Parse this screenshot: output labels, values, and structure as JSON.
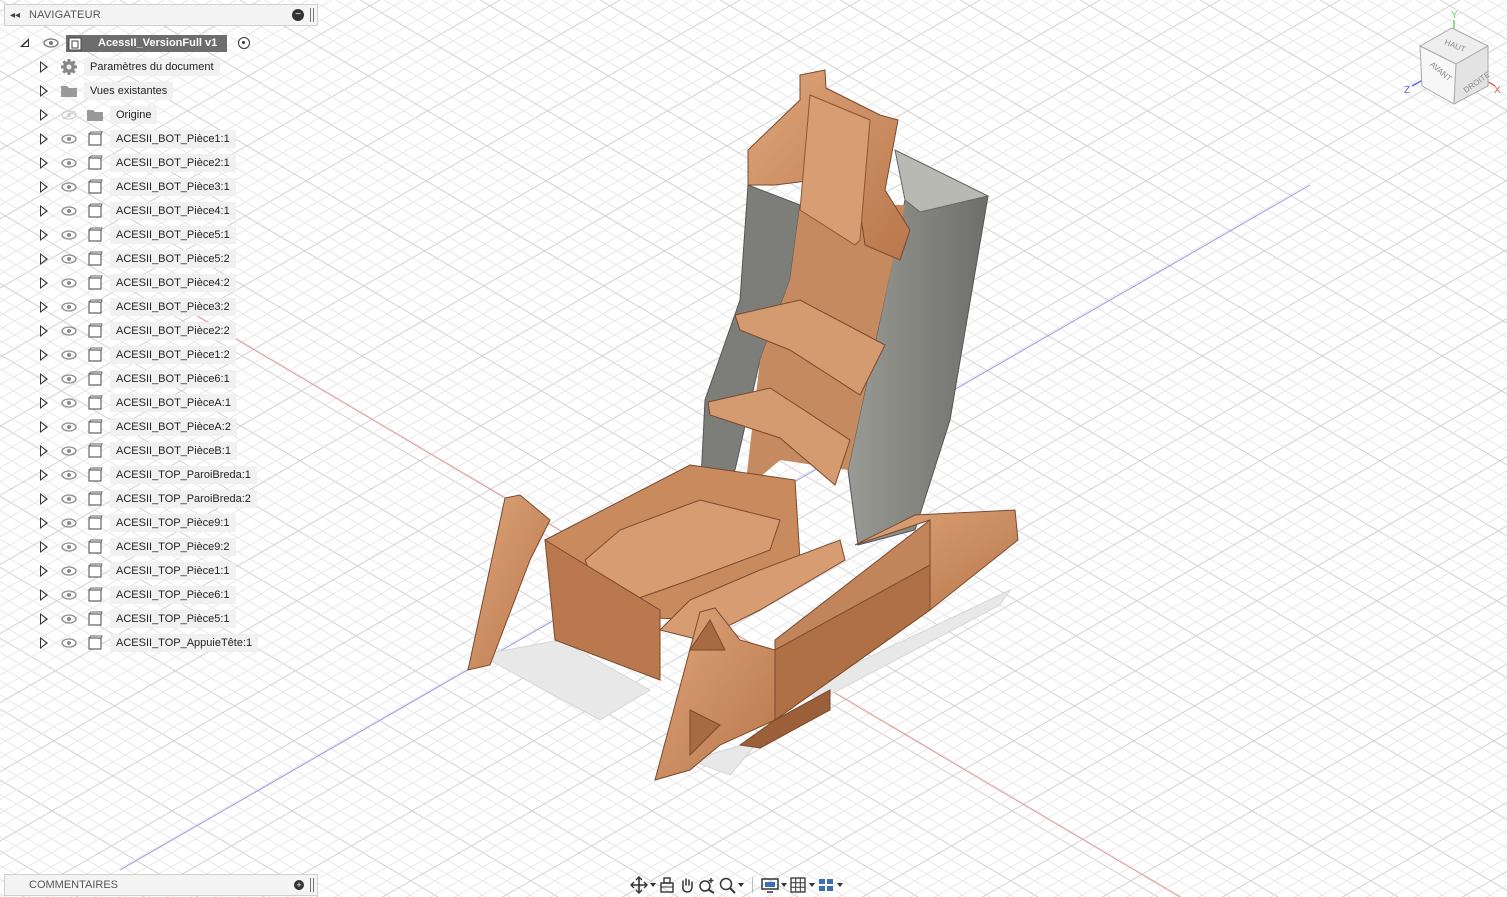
{
  "navigator": {
    "title": "NAVIGATEUR",
    "root": {
      "label": "AcessII_VersionFull v1"
    },
    "items": [
      {
        "label": "Paramètres du document",
        "icon": "gear-icon",
        "eye": false
      },
      {
        "label": "Vues existantes",
        "icon": "folder-icon",
        "eye": false
      },
      {
        "label": "Origine",
        "icon": "folder-icon",
        "eye": "hidden"
      },
      {
        "label": "ACESII_BOT_Pièce1:1",
        "icon": "component-icon",
        "eye": true
      },
      {
        "label": "ACESII_BOT_Pièce2:1",
        "icon": "component-icon",
        "eye": true
      },
      {
        "label": "ACESII_BOT_Pièce3:1",
        "icon": "component-icon",
        "eye": true
      },
      {
        "label": "ACESII_BOT_Pièce4:1",
        "icon": "component-icon",
        "eye": true
      },
      {
        "label": "ACESII_BOT_Pièce5:1",
        "icon": "component-icon",
        "eye": true
      },
      {
        "label": "ACESII_BOT_Pièce5:2",
        "icon": "component-icon",
        "eye": true
      },
      {
        "label": "ACESII_BOT_Pièce4:2",
        "icon": "component-icon",
        "eye": true
      },
      {
        "label": "ACESII_BOT_Pièce3:2",
        "icon": "component-icon",
        "eye": true
      },
      {
        "label": "ACESII_BOT_Pièce2:2",
        "icon": "component-icon",
        "eye": true
      },
      {
        "label": "ACESII_BOT_Pièce1:2",
        "icon": "component-icon",
        "eye": true
      },
      {
        "label": "ACESII_BOT_Pièce6:1",
        "icon": "component-icon",
        "eye": true
      },
      {
        "label": "ACESII_BOT_PièceA:1",
        "icon": "component-icon",
        "eye": true
      },
      {
        "label": "ACESII_BOT_PièceA:2",
        "icon": "component-icon",
        "eye": true
      },
      {
        "label": "ACESII_BOT_PièceB:1",
        "icon": "component-icon",
        "eye": true
      },
      {
        "label": "ACESII_TOP_ParoiBreda:1",
        "icon": "component-icon",
        "eye": true
      },
      {
        "label": "ACESII_TOP_ParoiBreda:2",
        "icon": "component-icon",
        "eye": true
      },
      {
        "label": "ACESII_TOP_Pièce9:1",
        "icon": "component-icon",
        "eye": true
      },
      {
        "label": "ACESII_TOP_Pièce9:2",
        "icon": "component-icon",
        "eye": true
      },
      {
        "label": "ACESII_TOP_Pièce1:1",
        "icon": "component-icon",
        "eye": true
      },
      {
        "label": "ACESII_TOP_Pièce6:1",
        "icon": "component-icon",
        "eye": true
      },
      {
        "label": "ACESII_TOP_Pièce5:1",
        "icon": "component-icon",
        "eye": true
      },
      {
        "label": "ACESII_TOP_AppuieTête:1",
        "icon": "component-icon",
        "eye": true
      }
    ]
  },
  "comments": {
    "title": "COMMENTAIRES"
  },
  "viewcube": {
    "top": "HAUT",
    "front": "AVANT",
    "right": "DROITE",
    "axis_x": "X",
    "axis_y": "Y",
    "axis_z": "Z"
  },
  "toolbar": {
    "tools": [
      "orbit-icon",
      "look-at-icon",
      "pan-icon",
      "zoom-icon",
      "fit-icon",
      "display-settings-icon",
      "grid-settings-icon",
      "viewports-icon"
    ]
  },
  "colors": {
    "wood": "#c98a5e",
    "wood_light": "#dba27a",
    "wood_dark": "#8a5535",
    "panel_grey": "#8a8a86",
    "grid": "#dcdcdc",
    "axis_red": "#e08080",
    "axis_blue": "#8080e0"
  }
}
